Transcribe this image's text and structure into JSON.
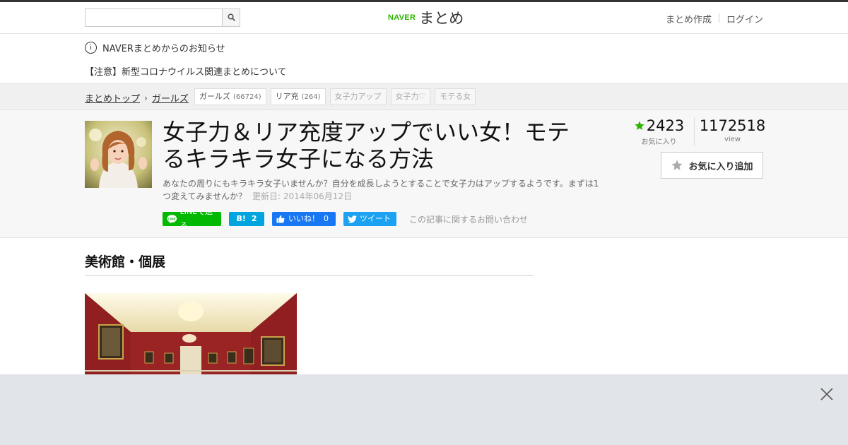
{
  "header": {
    "search_placeholder": "",
    "logo_naver": "NAVER",
    "logo_matome": "まとめ",
    "links": [
      "まとめ作成",
      "ログイン"
    ]
  },
  "notices": {
    "info": "NAVERまとめからのお知らせ",
    "corona": "【注意】新型コロナウイルス関連まとめについて"
  },
  "breadcrumb": {
    "top": "まとめトップ",
    "category": "ガールズ"
  },
  "tags": [
    {
      "label": "ガールズ",
      "count": "(66724)",
      "muted": false
    },
    {
      "label": "リア充",
      "count": "(264)",
      "muted": false
    },
    {
      "label": "女子力アップ",
      "count": "",
      "muted": true
    },
    {
      "label": "女子力♡",
      "count": "",
      "muted": true
    },
    {
      "label": "モテる女",
      "count": "",
      "muted": true
    }
  ],
  "article": {
    "title": "女子力＆リア充度アップでいい女！モテるキラキラ女子になる方法",
    "description": "あなたの周りにもキラキラ女子いませんか？自分を成長しようとすることで女子力はアップするようです。まずは1つ変えてみませんか？",
    "updated": "更新日: 2014年06月12日"
  },
  "share": {
    "line": "LINEで送る",
    "hatena_icon": "B!",
    "hatena_count": "2",
    "fb": "いいね！",
    "fb_count": "0",
    "twitter": "ツイート",
    "contact": "この記事に関するお問い合わせ"
  },
  "stats": {
    "favorites": "2423",
    "favorites_label": "お気に入り",
    "views": "1172518",
    "views_label": "view",
    "fav_button": "お気に入り追加"
  },
  "section": {
    "title": "美術館・個展"
  },
  "colors": {
    "naver_green": "#2db400",
    "line_green": "#00b900",
    "hatena_blue": "#00a4de",
    "fb_blue": "#1877f2",
    "twitter_blue": "#1da1f2"
  }
}
